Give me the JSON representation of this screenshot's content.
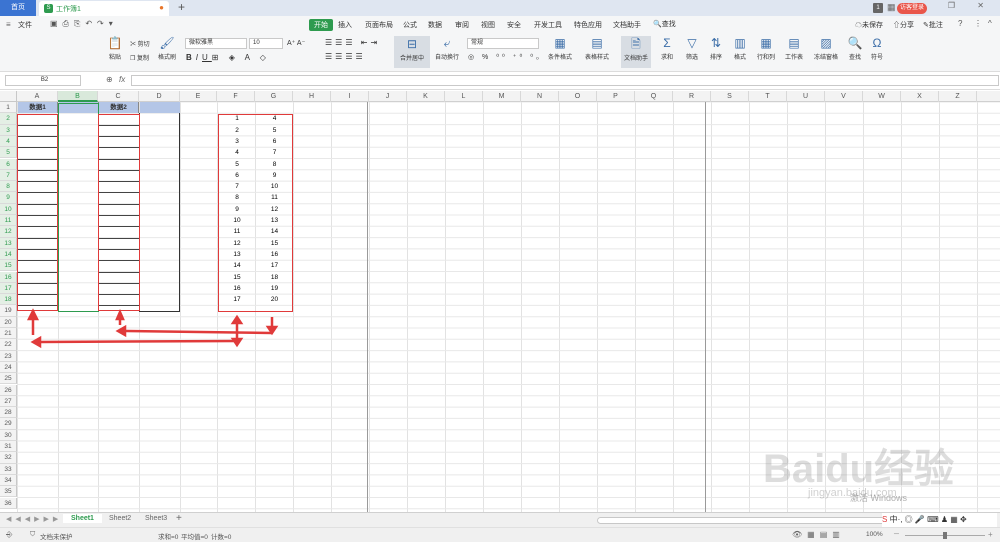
{
  "tabs": {
    "home": "首页",
    "doc": "工作簿1",
    "new_tab": "+",
    "count": "1"
  },
  "menu": {
    "file": "文件",
    "items": [
      "开始",
      "插入",
      "页面布局",
      "公式",
      "数据",
      "审阅",
      "视图",
      "安全",
      "开发工具",
      "特色应用",
      "文档助手"
    ],
    "search": "查找",
    "login": "访客登录",
    "unsaved": "未保存",
    "share": "分享",
    "comment": "批注"
  },
  "ribbon": {
    "paste": "粘贴",
    "cut": "剪切",
    "copy": "复制",
    "format_painter": "格式刷",
    "font_name": "微软雅黑",
    "font_size": "10",
    "merge": "合并居中",
    "wrap": "自动换行",
    "number_format": "常规",
    "cond_format": "条件格式",
    "table_style": "表格样式",
    "doc_helper": "文档助手",
    "sum": "求和",
    "filter": "筛选",
    "sort": "排序",
    "format": "格式",
    "rowcol": "行和列",
    "worksheet": "工作表",
    "freeze": "冻结窗格",
    "find": "查找",
    "symbol": "符号"
  },
  "formula": {
    "namebox": "B2",
    "fx": "fx",
    "value": ""
  },
  "columns": [
    "A",
    "B",
    "C",
    "D",
    "E",
    "F",
    "G",
    "H",
    "I",
    "J",
    "K",
    "L",
    "M",
    "N",
    "O",
    "P",
    "Q",
    "R",
    "S",
    "T",
    "U",
    "V",
    "W",
    "X",
    "Z"
  ],
  "rows": [
    "1",
    "2",
    "3",
    "4",
    "5",
    "6",
    "7",
    "8",
    "9",
    "10",
    "11",
    "12",
    "13",
    "14",
    "15",
    "16",
    "17",
    "18",
    "19",
    "20",
    "21",
    "22",
    "23",
    "24",
    "25",
    "26",
    "27",
    "28",
    "29",
    "30",
    "31",
    "32",
    "33",
    "34",
    "35",
    "36"
  ],
  "headers": {
    "a1": "数据1",
    "c1": "数据2"
  },
  "table_f": [
    "1",
    "2",
    "3",
    "4",
    "5",
    "6",
    "7",
    "8",
    "9",
    "10",
    "11",
    "12",
    "13",
    "14",
    "15",
    "16",
    "17"
  ],
  "table_g": [
    "4",
    "5",
    "6",
    "7",
    "8",
    "9",
    "10",
    "11",
    "12",
    "13",
    "14",
    "15",
    "16",
    "17",
    "18",
    "19",
    "20"
  ],
  "sheets": [
    "Sheet1",
    "Sheet2",
    "Sheet3"
  ],
  "status": {
    "protect": "文档未保护",
    "sum": "求和=0",
    "avg": "平均值=0",
    "count": "计数=0",
    "zoom": "100%"
  },
  "watermark": {
    "brand": "Baidu经验",
    "url": "jingyan.baidu.com",
    "activate": "激活 Windows",
    "activate_hint": "转到'设置'以激活 Windows"
  },
  "colors": {
    "accent": "#2e9b4f",
    "header_fill": "#b4c6e7",
    "annotation": "#e03a3a"
  }
}
